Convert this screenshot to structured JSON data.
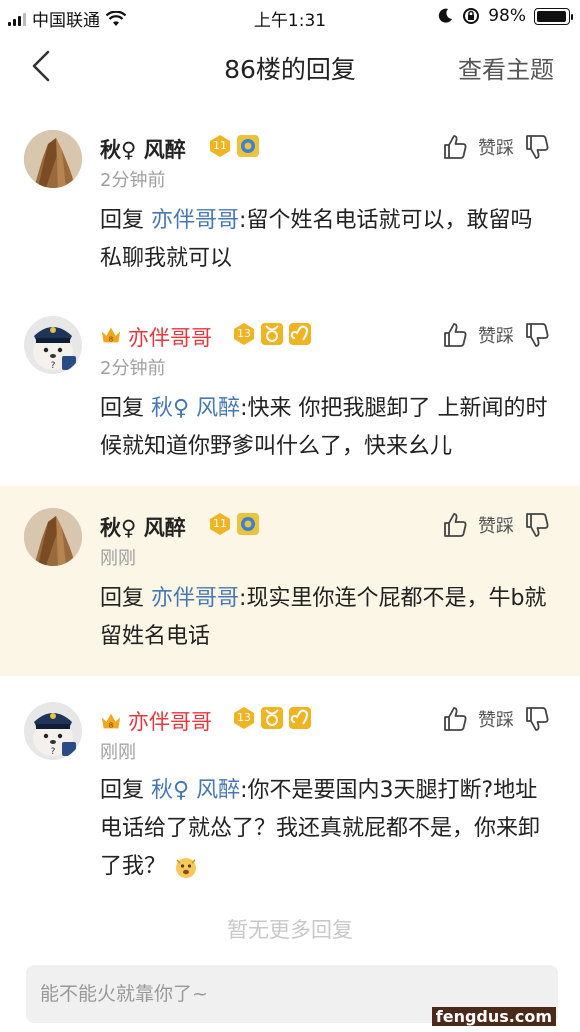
{
  "status_bar": {
    "carrier": "中国联通",
    "time": "上午1:31",
    "battery_pct": "98%",
    "battery_level": 0.98
  },
  "nav": {
    "title": "86楼的回复",
    "action": "查看主题"
  },
  "vote_labels": {
    "up": "赞",
    "down": "踩"
  },
  "replies": [
    {
      "username": "秋♀ 风醉",
      "time": "2分钟前",
      "reply_prefix": "回复",
      "mention": "亦伴哥哥",
      "text": ":留个姓名电话就可以，敢留吗私聊我就可以"
    },
    {
      "username": "亦伴哥哥",
      "time": "2分钟前",
      "reply_prefix": "回复",
      "mention": "秋♀ 风醉",
      "text": ":快来 你把我腿卸了 上新闻的时候就知道你野爹叫什么了，快来幺儿"
    },
    {
      "username": "秋♀ 风醉",
      "time": "刚刚",
      "reply_prefix": "回复",
      "mention": "亦伴哥哥",
      "text": ":现实里你连个屁都不是，牛b就留姓名电话"
    },
    {
      "username": "亦伴哥哥",
      "time": "刚刚",
      "reply_prefix": "回复",
      "mention": "秋♀ 风醉",
      "text": ":你不是要国内3天腿打断?地址电话给了就怂了？我还真就屁都不是，你来卸了我？"
    }
  ],
  "badges": {
    "level_a": "11",
    "level_b": "13"
  },
  "no_more": "暂无更多回复",
  "input_placeholder": "能不能火就靠你了~",
  "watermark": "fengdus.com",
  "colors": {
    "mention": "#4678b6",
    "vip_name": "#e5373c",
    "highlight_bg": "#fbf6e6"
  }
}
